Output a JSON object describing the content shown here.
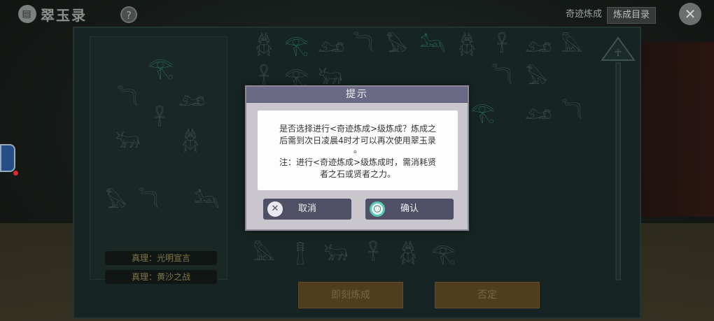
{
  "app": {
    "title": "翠玉录",
    "help_label": "?"
  },
  "top_tabs": [
    {
      "label": "奇迹炼成",
      "active": false
    },
    {
      "label": "炼成目录",
      "active": true
    }
  ],
  "close_label": "✕",
  "truths": [
    "真理：光明宣言",
    "真理：黄沙之战"
  ],
  "bottom_buttons": {
    "left": "即刻炼成",
    "right": "否定"
  },
  "dialog": {
    "title": "提示",
    "line1": "是否选择进行<奇迹炼成>级炼成？炼成之",
    "line2": "后需到次日凌晨4时才可以再次使用翠玉录",
    "line3": "。",
    "line4": "注：进行<奇迹炼成>级炼成时，需消耗贤",
    "line5": "者之石或贤者之力。",
    "cancel_label": "取消",
    "confirm_label": "确认"
  },
  "glyphs": {
    "row1": [
      "𓆣",
      "𓂀",
      "𓃭",
      "𓆓",
      "𓅃",
      "𓃢",
      "𓆣",
      "𓋹",
      "𓃭",
      "𓅓"
    ],
    "row2": [
      "𓋹",
      "𓂀",
      "𓃒",
      "𓆓",
      "𓅃",
      "𓂀",
      "𓃭",
      "𓆓"
    ],
    "row3": [
      "𓅓",
      "𓊽",
      "𓃒",
      "𓋹",
      "𓆣",
      "𓂀"
    ],
    "left_col": [
      "𓂀",
      "𓆓",
      "𓃭",
      "𓋹",
      "𓃒",
      "𓆣",
      "𓅃",
      "𓆓",
      "𓃢"
    ]
  },
  "colors": {
    "gold_text": "#d8c878",
    "teal": "#4fb3a6",
    "dialog_button": "#4f5065"
  }
}
